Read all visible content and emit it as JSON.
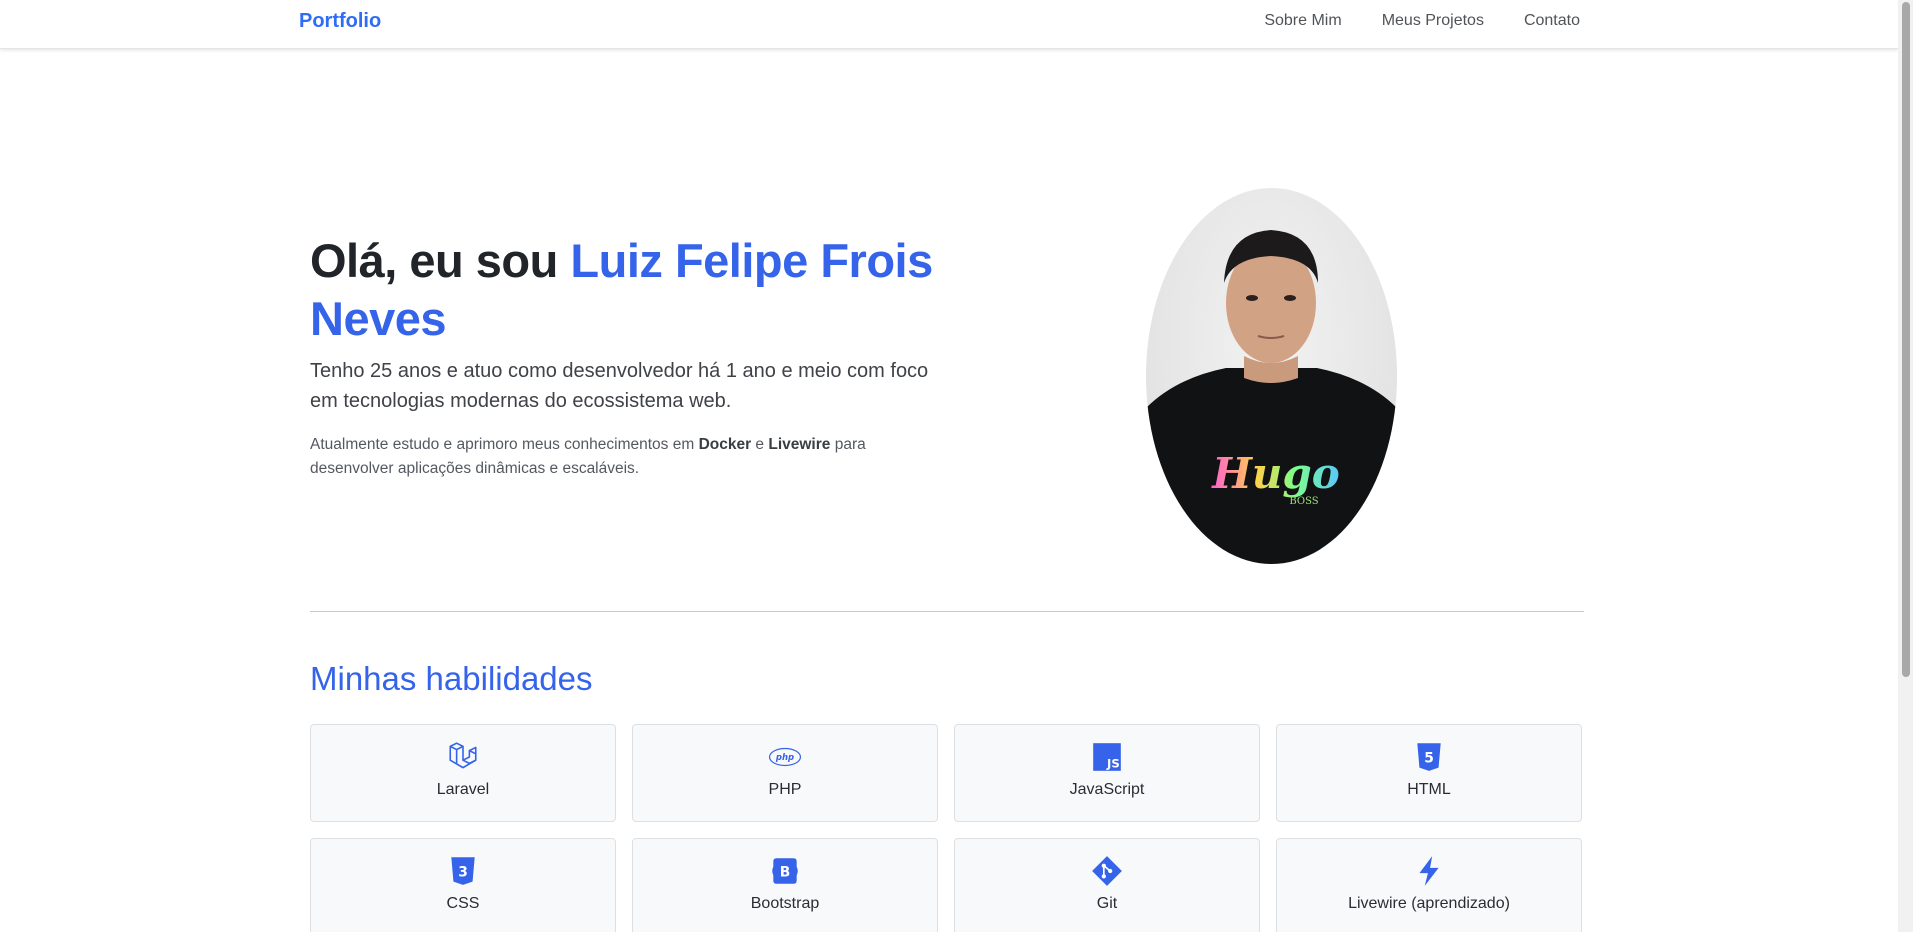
{
  "navbar": {
    "brand": "Portfolio",
    "links": [
      "Sobre Mim",
      "Meus Projetos",
      "Contato"
    ]
  },
  "hero": {
    "greeting": "Olá, eu sou ",
    "name": "Luiz Felipe Frois Neves",
    "lead": "Tenho 25 anos e atuo como desenvolvedor há 1 ano e meio com foco em tecnologias modernas do ecossistema web.",
    "desc_prefix": "Atualmente estudo e aprimoro meus conhecimentos em ",
    "desc_tech1": "Docker",
    "desc_and": " e ",
    "desc_tech2": "Livewire",
    "desc_suffix": " para desenvolver aplicações dinâmicas e escaláveis.",
    "shirt_text": "Hugo",
    "shirt_subtext": "BOSS"
  },
  "skills": {
    "title": "Minhas habilidades",
    "items": [
      {
        "label": "Laravel",
        "icon": "laravel-icon"
      },
      {
        "label": "PHP",
        "icon": "php-icon"
      },
      {
        "label": "JavaScript",
        "icon": "javascript-icon"
      },
      {
        "label": "HTML",
        "icon": "html5-icon"
      },
      {
        "label": "CSS",
        "icon": "css3-icon"
      },
      {
        "label": "Bootstrap",
        "icon": "bootstrap-icon"
      },
      {
        "label": "Git",
        "icon": "git-icon"
      },
      {
        "label": "Livewire (aprendizado)",
        "icon": "lightning-icon"
      }
    ]
  },
  "colors": {
    "accent": "#3563e9",
    "brand": "#2f6df6",
    "card_bg": "#f8f9fa"
  }
}
